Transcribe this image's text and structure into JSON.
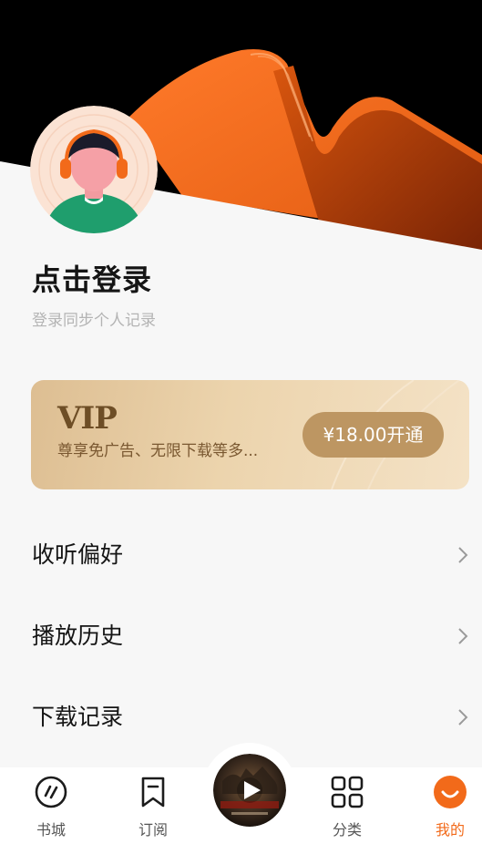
{
  "profile": {
    "login_title": "点击登录",
    "login_subtitle": "登录同步个人记录",
    "avatar_icon": "user-headphones-avatar"
  },
  "vip": {
    "logo": "VIP",
    "description": "尊享免广告、无限下载等多...",
    "button_label": "¥18.00开通",
    "colors": {
      "card": "#e8cda3",
      "button": "#bd9662",
      "text": "#7a5831"
    }
  },
  "menu": [
    {
      "label": "收听偏好",
      "icon": "chevron-right-icon"
    },
    {
      "label": "播放历史",
      "icon": "chevron-right-icon"
    },
    {
      "label": "下载记录",
      "icon": "chevron-right-icon"
    }
  ],
  "tabbar": {
    "tabs": [
      {
        "label": "书城",
        "icon": "bookstore-icon"
      },
      {
        "label": "订阅",
        "icon": "bookmark-icon"
      },
      {
        "label": "分类",
        "icon": "grid-icon"
      },
      {
        "label": "我的",
        "icon": "mine-icon",
        "active": true
      }
    ],
    "player_icon": "play-icon",
    "accent": "#f26a1a"
  }
}
